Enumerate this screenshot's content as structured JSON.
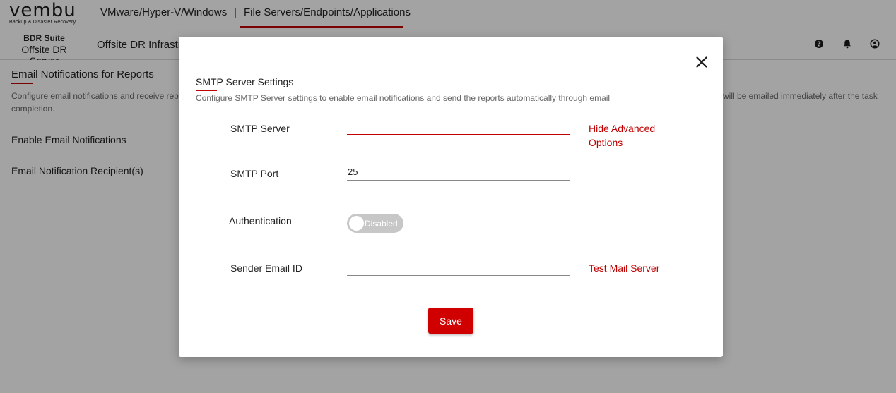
{
  "header": {
    "logo_text": "vembu",
    "logo_tagline": "Backup & Disaster Recovery",
    "nav_vmware": "VMware/Hyper-V/Windows",
    "nav_separator": "|",
    "nav_file": "File Servers/Endpoints/Applications"
  },
  "subheader": {
    "suite_title": "BDR Suite",
    "suite_sub": "Offsite DR Server",
    "nav_offsite": "Offsite DR Infrastru"
  },
  "background": {
    "section_title": "Email Notifications for Reports",
    "section_desc_left": "Configure email notifications and receive repo completion.",
    "section_desc_right": "will be emailed immediately after the task",
    "row_enable": "Enable Email Notifications",
    "row_recipient": "Email Notification Recipient(s)"
  },
  "modal": {
    "title": "SMTP Server Settings",
    "description": "Configure SMTP Server settings to enable email notifications and send the reports automatically through email",
    "smtp_server_label": "SMTP Server",
    "smtp_server_value": "",
    "hide_advanced": "Hide Advanced Options",
    "smtp_port_label": "SMTP Port",
    "smtp_port_value": "25",
    "authentication_label": "Authentication",
    "authentication_toggle": "Disabled",
    "sender_email_label": "Sender Email ID",
    "sender_email_value": "",
    "test_mail": "Test Mail Server",
    "save_label": "Save"
  },
  "colors": {
    "accent": "#c00000",
    "button": "#d00000",
    "toggle_off": "#c7c7c7"
  }
}
